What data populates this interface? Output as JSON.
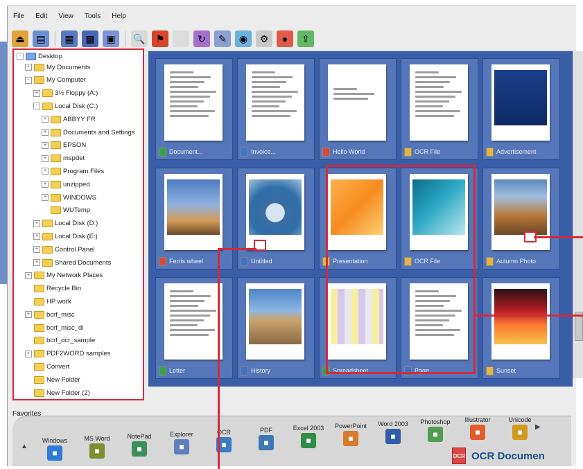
{
  "menu": [
    "File",
    "Edit",
    "View",
    "Tools",
    "Help"
  ],
  "tree": {
    "root": "Desktop",
    "items": [
      {
        "label": "My Documents",
        "indent": 1,
        "exp": "+"
      },
      {
        "label": "My Computer",
        "indent": 1,
        "exp": "-"
      },
      {
        "label": "3½ Floppy (A:)",
        "indent": 2,
        "exp": "+"
      },
      {
        "label": "Local Disk (C:)",
        "indent": 2,
        "exp": "-"
      },
      {
        "label": "ABBYY FR",
        "indent": 3,
        "exp": "+"
      },
      {
        "label": "Documents and Settings",
        "indent": 3,
        "exp": "+"
      },
      {
        "label": "EPSON",
        "indent": 3,
        "exp": "+"
      },
      {
        "label": "mspdet",
        "indent": 3,
        "exp": "+"
      },
      {
        "label": "Program Files",
        "indent": 3,
        "exp": "+"
      },
      {
        "label": "unzipped",
        "indent": 3,
        "exp": "+"
      },
      {
        "label": "WINDOWS",
        "indent": 3,
        "exp": "+"
      },
      {
        "label": "WUTemp",
        "indent": 3,
        "exp": ""
      },
      {
        "label": "Local Disk (D:)",
        "indent": 2,
        "exp": "+"
      },
      {
        "label": "Local Disk (E:)",
        "indent": 2,
        "exp": "+"
      },
      {
        "label": "Control Panel",
        "indent": 2,
        "exp": "+"
      },
      {
        "label": "Shared Documents",
        "indent": 2,
        "exp": "+"
      },
      {
        "label": "My Network Places",
        "indent": 1,
        "exp": "+"
      },
      {
        "label": "Recycle Bin",
        "indent": 1,
        "exp": ""
      },
      {
        "label": "HP work",
        "indent": 1,
        "exp": ""
      },
      {
        "label": "bcrf_misc",
        "indent": 1,
        "exp": "+"
      },
      {
        "label": "bcrf_misc_dl",
        "indent": 1,
        "exp": ""
      },
      {
        "label": "bcrf_ocr_sample",
        "indent": 1,
        "exp": ""
      },
      {
        "label": "PDF2WORD samples",
        "indent": 1,
        "exp": "+"
      },
      {
        "label": "Convert",
        "indent": 1,
        "exp": ""
      },
      {
        "label": "New Folder",
        "indent": 1,
        "exp": ""
      },
      {
        "label": "New Folder (2)",
        "indent": 1,
        "exp": ""
      }
    ]
  },
  "thumbs": [
    {
      "label": "Document...",
      "icon": "green",
      "type": "doc"
    },
    {
      "label": "Invoice...",
      "icon": "blue",
      "type": "doc2"
    },
    {
      "label": "Hello World",
      "icon": "red",
      "type": "title"
    },
    {
      "label": "OCR File",
      "icon": "yellow",
      "type": "text"
    },
    {
      "label": "Advertisement",
      "icon": "yellow",
      "type": "slide"
    },
    {
      "label": "Ferris wheel",
      "icon": "red",
      "type": "photo",
      "photo": "ferris"
    },
    {
      "label": "Untitled",
      "icon": "blue",
      "type": "photo",
      "photo": "wheel"
    },
    {
      "label": "Presentation",
      "icon": "yellow",
      "type": "photo",
      "photo": "orange"
    },
    {
      "label": "OCR File",
      "icon": "yellow",
      "type": "photo",
      "photo": "teal"
    },
    {
      "label": "Autumn Photo",
      "icon": "yellow",
      "type": "photo",
      "photo": "autumn"
    },
    {
      "label": "Letter",
      "icon": "green",
      "type": "doc"
    },
    {
      "label": "History",
      "icon": "blue",
      "type": "photo",
      "photo": "colosseum"
    },
    {
      "label": "Spreadsheet",
      "icon": "green",
      "type": "sheet"
    },
    {
      "label": "Page",
      "icon": "blue",
      "type": "page"
    },
    {
      "label": "Sunset",
      "icon": "yellow",
      "type": "photo",
      "photo": "sunset"
    }
  ],
  "dock": {
    "title": "Favorites",
    "items": [
      {
        "label": "Windows",
        "color": "#2f7bd8"
      },
      {
        "label": "MS Word",
        "color": "#7c8f30"
      },
      {
        "label": "NotePad",
        "color": "#3a8f5a"
      },
      {
        "label": "Explorer",
        "color": "#5b7fbf"
      },
      {
        "label": "OCR",
        "color": "#3b7bc7"
      },
      {
        "label": "PDF",
        "color": "#3d77b6"
      },
      {
        "label": "Excel 2003",
        "color": "#2f8d44"
      },
      {
        "label": "PowerPoint",
        "color": "#d97a26"
      },
      {
        "label": "Word 2003",
        "color": "#2e5ea8"
      },
      {
        "label": "Photoshop",
        "color": "#4f9d4f"
      },
      {
        "label": "Illustrator",
        "color": "#e35c2c"
      },
      {
        "label": "Unicode",
        "color": "#d49a1f"
      }
    ]
  },
  "footer": {
    "badge": "OCR",
    "text": "OCR Documen"
  }
}
